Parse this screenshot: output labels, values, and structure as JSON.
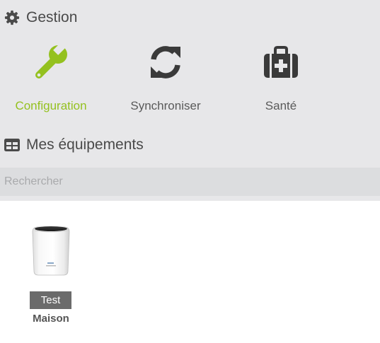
{
  "gestion": {
    "title": "Gestion",
    "icon": "gear-icon",
    "actions": [
      {
        "label": "Configuration",
        "icon": "wrench-icon",
        "color": "#94c11f"
      },
      {
        "label": "Synchroniser",
        "icon": "sync-icon",
        "color": "#3a3a3a"
      },
      {
        "label": "Santé",
        "icon": "medical-kit-icon",
        "color": "#3a3a3a"
      }
    ]
  },
  "equipements": {
    "title": "Mes équipements",
    "icon": "table-icon",
    "search": {
      "placeholder": "Rechercher",
      "value": ""
    },
    "devices": [
      {
        "name": "Test",
        "room": "Maison",
        "icon": "device-box-image"
      }
    ]
  },
  "colors": {
    "accent": "#94c11f",
    "top_background": "#e7e7e9",
    "search_background": "#dcdddf",
    "label_background": "#6b6b6b"
  }
}
